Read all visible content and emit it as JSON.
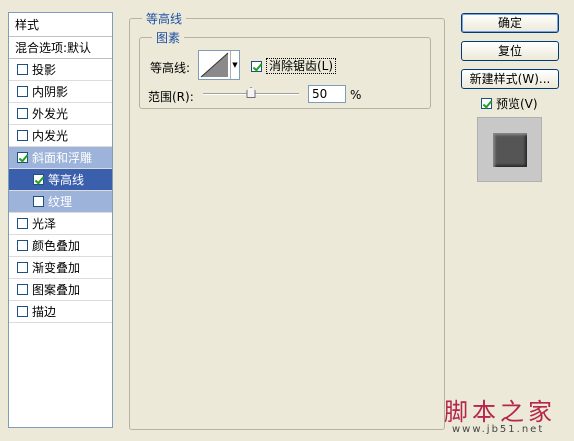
{
  "styles_panel": {
    "header": "样式",
    "blend_options": "混合选项:默认",
    "items": [
      {
        "label": "投影",
        "checked": false
      },
      {
        "label": "内阴影",
        "checked": false
      },
      {
        "label": "外发光",
        "checked": false
      },
      {
        "label": "内发光",
        "checked": false
      },
      {
        "label": "斜面和浮雕",
        "checked": true
      },
      {
        "label": "等高线",
        "checked": true
      },
      {
        "label": "纹理",
        "checked": false
      },
      {
        "label": "光泽",
        "checked": false
      },
      {
        "label": "颜色叠加",
        "checked": false
      },
      {
        "label": "渐变叠加",
        "checked": false
      },
      {
        "label": "图案叠加",
        "checked": false
      },
      {
        "label": "描边",
        "checked": false
      }
    ]
  },
  "contour_group": {
    "title": "等高线",
    "image_group_title": "图素",
    "contour_label": "等高线:",
    "antialias_label": "消除锯齿(L)",
    "antialias_checked": true,
    "range_label": "范围(R):",
    "range_value": "50",
    "range_unit": "%",
    "range_fraction": 0.5
  },
  "buttons": {
    "ok": "确定",
    "reset": "复位",
    "new_style": "新建样式(W)..."
  },
  "preview": {
    "label": "预览(V)",
    "checked": true
  },
  "watermark": {
    "text": "脚本之家",
    "url": "www.jb51.net"
  }
}
